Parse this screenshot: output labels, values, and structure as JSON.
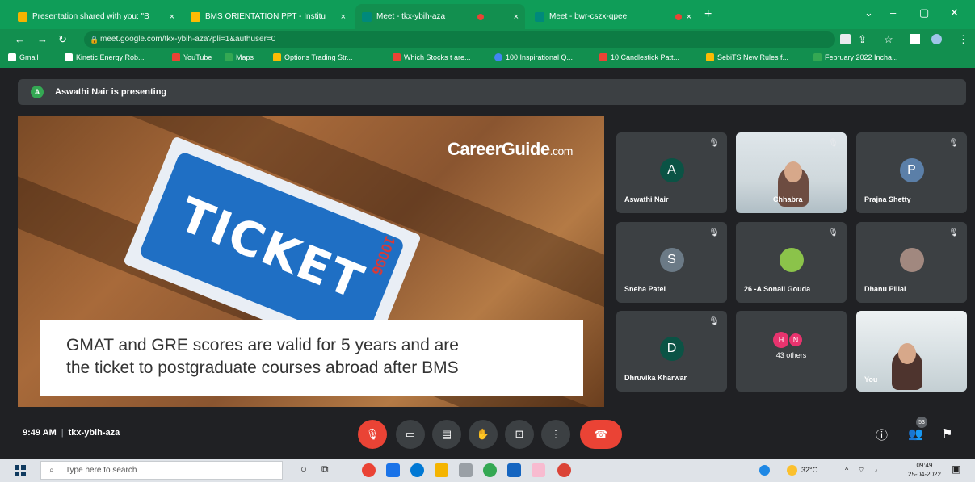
{
  "browser": {
    "tabs": [
      {
        "title": "Presentation shared with you: \"B",
        "active": false
      },
      {
        "title": "BMS ORIENTATION PPT - Institu",
        "active": false
      },
      {
        "title": "Meet - tkx-ybih-aza",
        "active": true
      },
      {
        "title": "Meet - bwr-cszx-qpee",
        "active": false
      }
    ],
    "url": "meet.google.com/tkx-ybih-aza?pli=1&authuser=0",
    "bookmarks": [
      "Gmail",
      "Kinetic Energy Rob...",
      "YouTube",
      "Maps",
      "Options Trading Str...",
      "Which Stocks t are...",
      "100 Inspirational Q...",
      "10 Candlestick Patt...",
      "SebiTS New Rules f...",
      "February 2022 Incha..."
    ]
  },
  "banner": {
    "avatar_letter": "A",
    "text": "Aswathi Nair is presenting"
  },
  "slide": {
    "brand": "CareerGuide",
    "brand_suffix": ".com",
    "ticket_word": "TICKET",
    "ticket_number": "10096",
    "caption_line1": "GMAT and GRE scores are valid for 5 years and are",
    "caption_line2": "the ticket to postgraduate courses abroad after BMS"
  },
  "participants": [
    {
      "name": "Aswathi Nair",
      "letter": "A",
      "color": "#0b5345"
    },
    {
      "name": "Chhabra",
      "video": true
    },
    {
      "name": "Prajna Shetty",
      "letter": "P",
      "color": "#5b7fa8"
    },
    {
      "name": "Sneha Patel",
      "letter": "S",
      "color": "#6b7a86"
    },
    {
      "name": "26 -A Sonali Gouda",
      "letter": "",
      "color": "#8bc34a"
    },
    {
      "name": "Dhanu Pillai",
      "letter": "",
      "color": "#a1887f"
    },
    {
      "name": "Dhruvika Kharwar",
      "letter": "D",
      "color": "#0b5345"
    },
    {
      "name": "43 others",
      "letter": "",
      "color": "#e8336e"
    },
    {
      "name": "You",
      "video": true
    }
  ],
  "others_badge": [
    "H",
    "N"
  ],
  "controls": {
    "time": "9:49 AM",
    "meeting_code": "tkx-ybih-aza",
    "people_count": "53"
  },
  "taskbar": {
    "search_placeholder": "Type here to search",
    "temperature": "32°C",
    "time": "09:49",
    "date": "25-04-2022"
  }
}
